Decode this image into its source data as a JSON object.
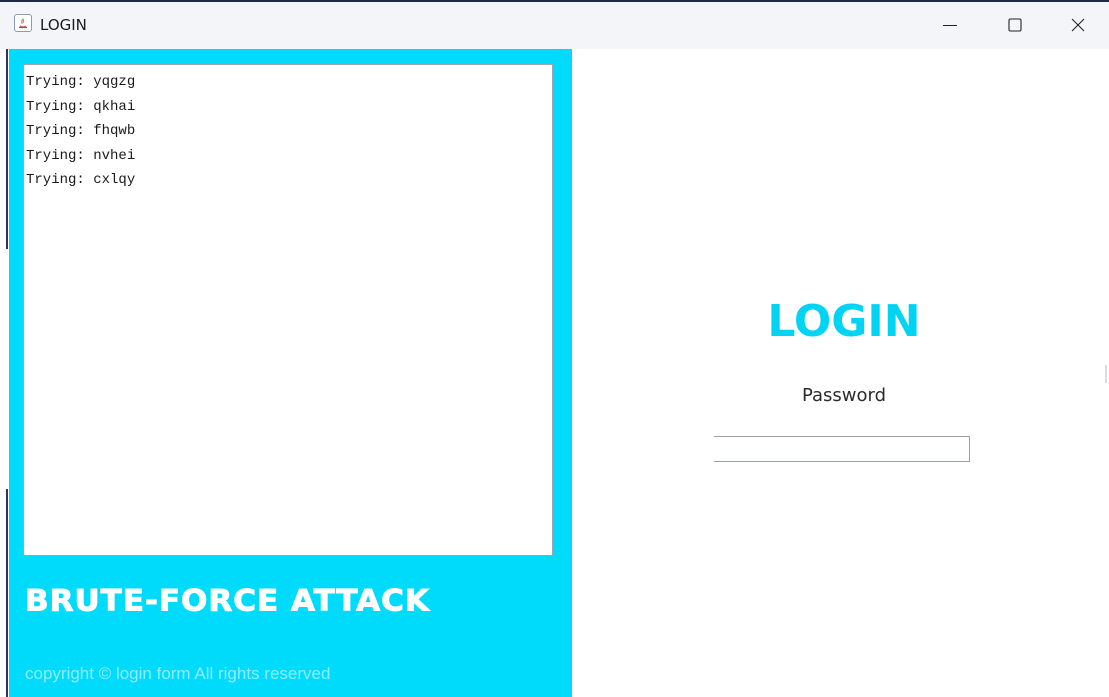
{
  "window": {
    "title": "LOGIN"
  },
  "log": {
    "lines": [
      "Trying: yqgzg",
      "Trying: qkhai",
      "Trying: fhqwb",
      "Trying: nvhei",
      "Trying: cxlqy"
    ]
  },
  "left_panel": {
    "brand": "BRUTE-FORCE ATTACK",
    "copyright": "copyright © login form All rights reserved"
  },
  "login": {
    "title": "LOGIN",
    "password_label": "Password",
    "password_value": ""
  },
  "colors": {
    "accent": "#00dbfb",
    "title_cyan": "#00d4f2",
    "titlebar_bg": "#f3f5f8"
  },
  "icons": {
    "app": "java-app-icon",
    "minimize": "minimize-icon",
    "maximize": "maximize-icon",
    "close": "close-icon"
  }
}
